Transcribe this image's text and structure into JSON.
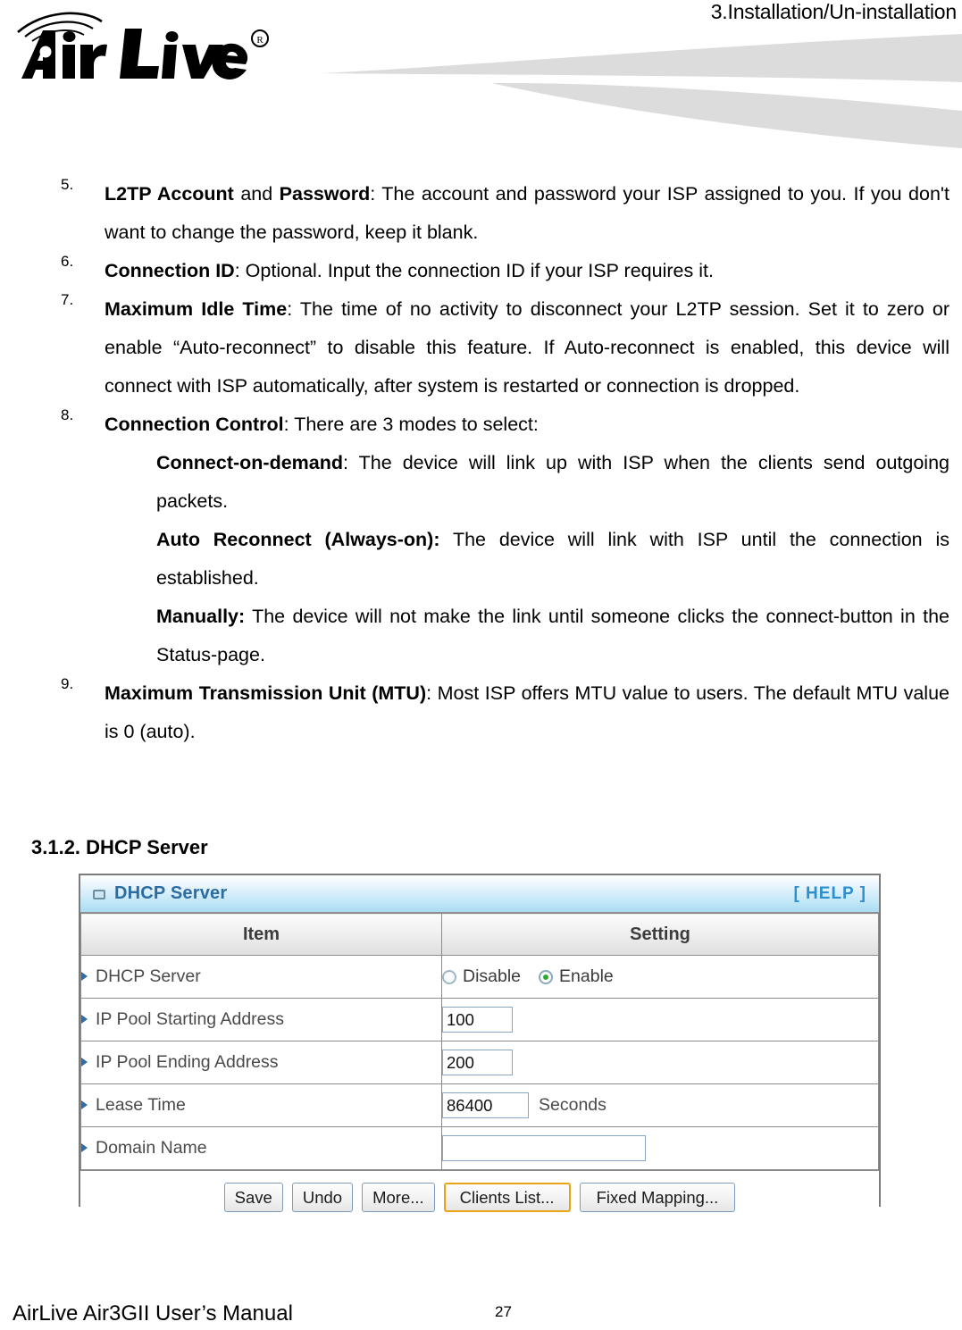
{
  "header": {
    "chapter_label": "3.Installation/Un-installation",
    "logo_text": "Air Live",
    "logo_registered": "®"
  },
  "body": {
    "steps": [
      {
        "number": "5.",
        "indent": false,
        "segments": [
          {
            "bold": true,
            "text": "L2TP Account"
          },
          {
            "bold": false,
            "text": " and "
          },
          {
            "bold": true,
            "text": "Password"
          },
          {
            "bold": false,
            "text": ": The account and password your ISP assigned to you. If you don't want to change the password, keep it blank."
          }
        ]
      },
      {
        "number": "6.",
        "indent": false,
        "segments": [
          {
            "bold": true,
            "text": "Connection ID"
          },
          {
            "bold": false,
            "text": ": Optional. Input the connection ID if your ISP requires it."
          }
        ]
      },
      {
        "number": "7.",
        "indent": false,
        "segments": [
          {
            "bold": true,
            "text": "Maximum Idle Time"
          },
          {
            "bold": false,
            "text": ": The time of no activity to disconnect your L2TP session. Set it to zero or enable “Auto-reconnect” to disable this feature. If Auto-reconnect is enabled, this device will connect with ISP automatically, after system is restarted or connection is dropped."
          }
        ]
      },
      {
        "number": "8.",
        "indent": false,
        "segments": [
          {
            "bold": true,
            "text": "Connection Control"
          },
          {
            "bold": false,
            "text": ": There are 3 modes to select:"
          }
        ]
      },
      {
        "number": "",
        "indent": true,
        "segments": [
          {
            "bold": true,
            "text": "Connect-on-demand"
          },
          {
            "bold": false,
            "text": ": The device will link up with ISP when the clients send outgoing packets."
          }
        ]
      },
      {
        "number": "",
        "indent": true,
        "segments": [
          {
            "bold": true,
            "text": "Auto Reconnect (Always-on):"
          },
          {
            "bold": false,
            "text": " The device will link with ISP until the connection is established."
          }
        ]
      },
      {
        "number": "",
        "indent": true,
        "segments": [
          {
            "bold": true,
            "text": "Manually:"
          },
          {
            "bold": false,
            "text": " The device will not make the link until someone clicks the connect-button in the Status-page."
          }
        ]
      },
      {
        "number": "9.",
        "indent": false,
        "segments": [
          {
            "bold": true,
            "text": "Maximum Transmission Unit (MTU)"
          },
          {
            "bold": false,
            "text": ": Most ISP offers MTU value to users. The default MTU value is 0 (auto)."
          }
        ]
      }
    ],
    "section_heading": "3.1.2. DHCP Server"
  },
  "dhcp_panel": {
    "title": "DHCP Server",
    "title_icon": "monitor-icon",
    "help_label": "[ HELP ]",
    "columns": [
      "Item",
      "Setting"
    ],
    "rows": [
      {
        "item": "DHCP Server",
        "control": "radio",
        "options": [
          "Disable",
          "Enable"
        ],
        "selected": "Enable"
      },
      {
        "item": "IP Pool Starting Address",
        "control": "text",
        "value": "100",
        "unit": ""
      },
      {
        "item": "IP Pool Ending Address",
        "control": "text",
        "value": "200",
        "unit": ""
      },
      {
        "item": "Lease Time",
        "control": "text",
        "value": "86400",
        "unit": "Seconds"
      },
      {
        "item": "Domain Name",
        "control": "text",
        "value": "",
        "unit": ""
      }
    ],
    "buttons": [
      {
        "label": "Save",
        "highlight": false
      },
      {
        "label": "Undo",
        "highlight": false
      },
      {
        "label": "More...",
        "highlight": false
      },
      {
        "label": "Clients List...",
        "highlight": true
      },
      {
        "label": "Fixed Mapping...",
        "highlight": false
      }
    ],
    "accent_highlight_color": "#e8a317",
    "title_text_color": "#2d6ca2",
    "radio_on_color": "#2eab2e"
  },
  "footer": {
    "manual_title": "AirLive Air3GII User’s Manual",
    "page_number": "27"
  }
}
